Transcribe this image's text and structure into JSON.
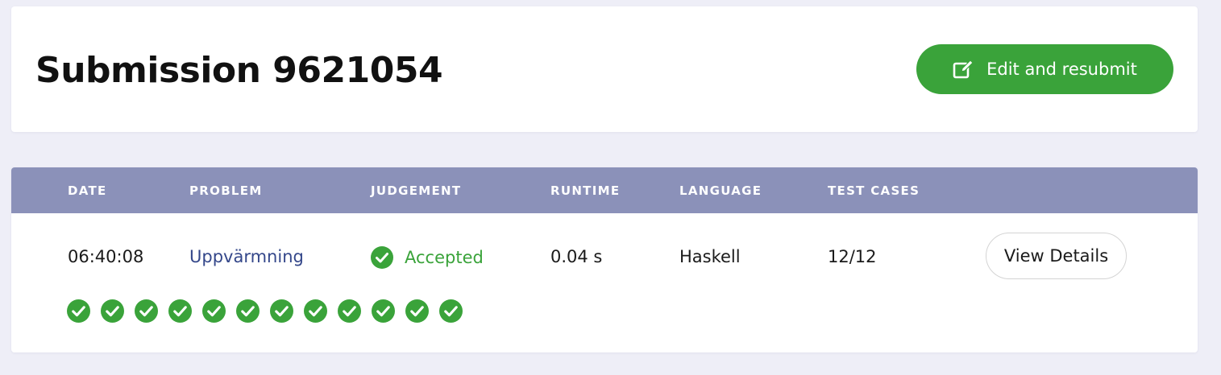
{
  "header": {
    "title": "Submission 9621054",
    "edit_button_label": "Edit and resubmit",
    "edit_icon": "edit-icon"
  },
  "table": {
    "columns": [
      "DATE",
      "PROBLEM",
      "JUDGEMENT",
      "RUNTIME",
      "LANGUAGE",
      "TEST CASES"
    ],
    "row": {
      "date": "06:40:08",
      "problem": "Uppvärmning",
      "judgement": "Accepted",
      "runtime": "0.04 s",
      "language": "Haskell",
      "test_cases": "12/12",
      "details_button_label": "View Details"
    },
    "test_case_results": [
      "passed",
      "passed",
      "passed",
      "passed",
      "passed",
      "passed",
      "passed",
      "passed",
      "passed",
      "passed",
      "passed",
      "passed"
    ]
  },
  "colors": {
    "accent_green": "#3aa33a",
    "table_header": "#8b91b9",
    "link": "#34478a",
    "background": "#eeeef7"
  }
}
